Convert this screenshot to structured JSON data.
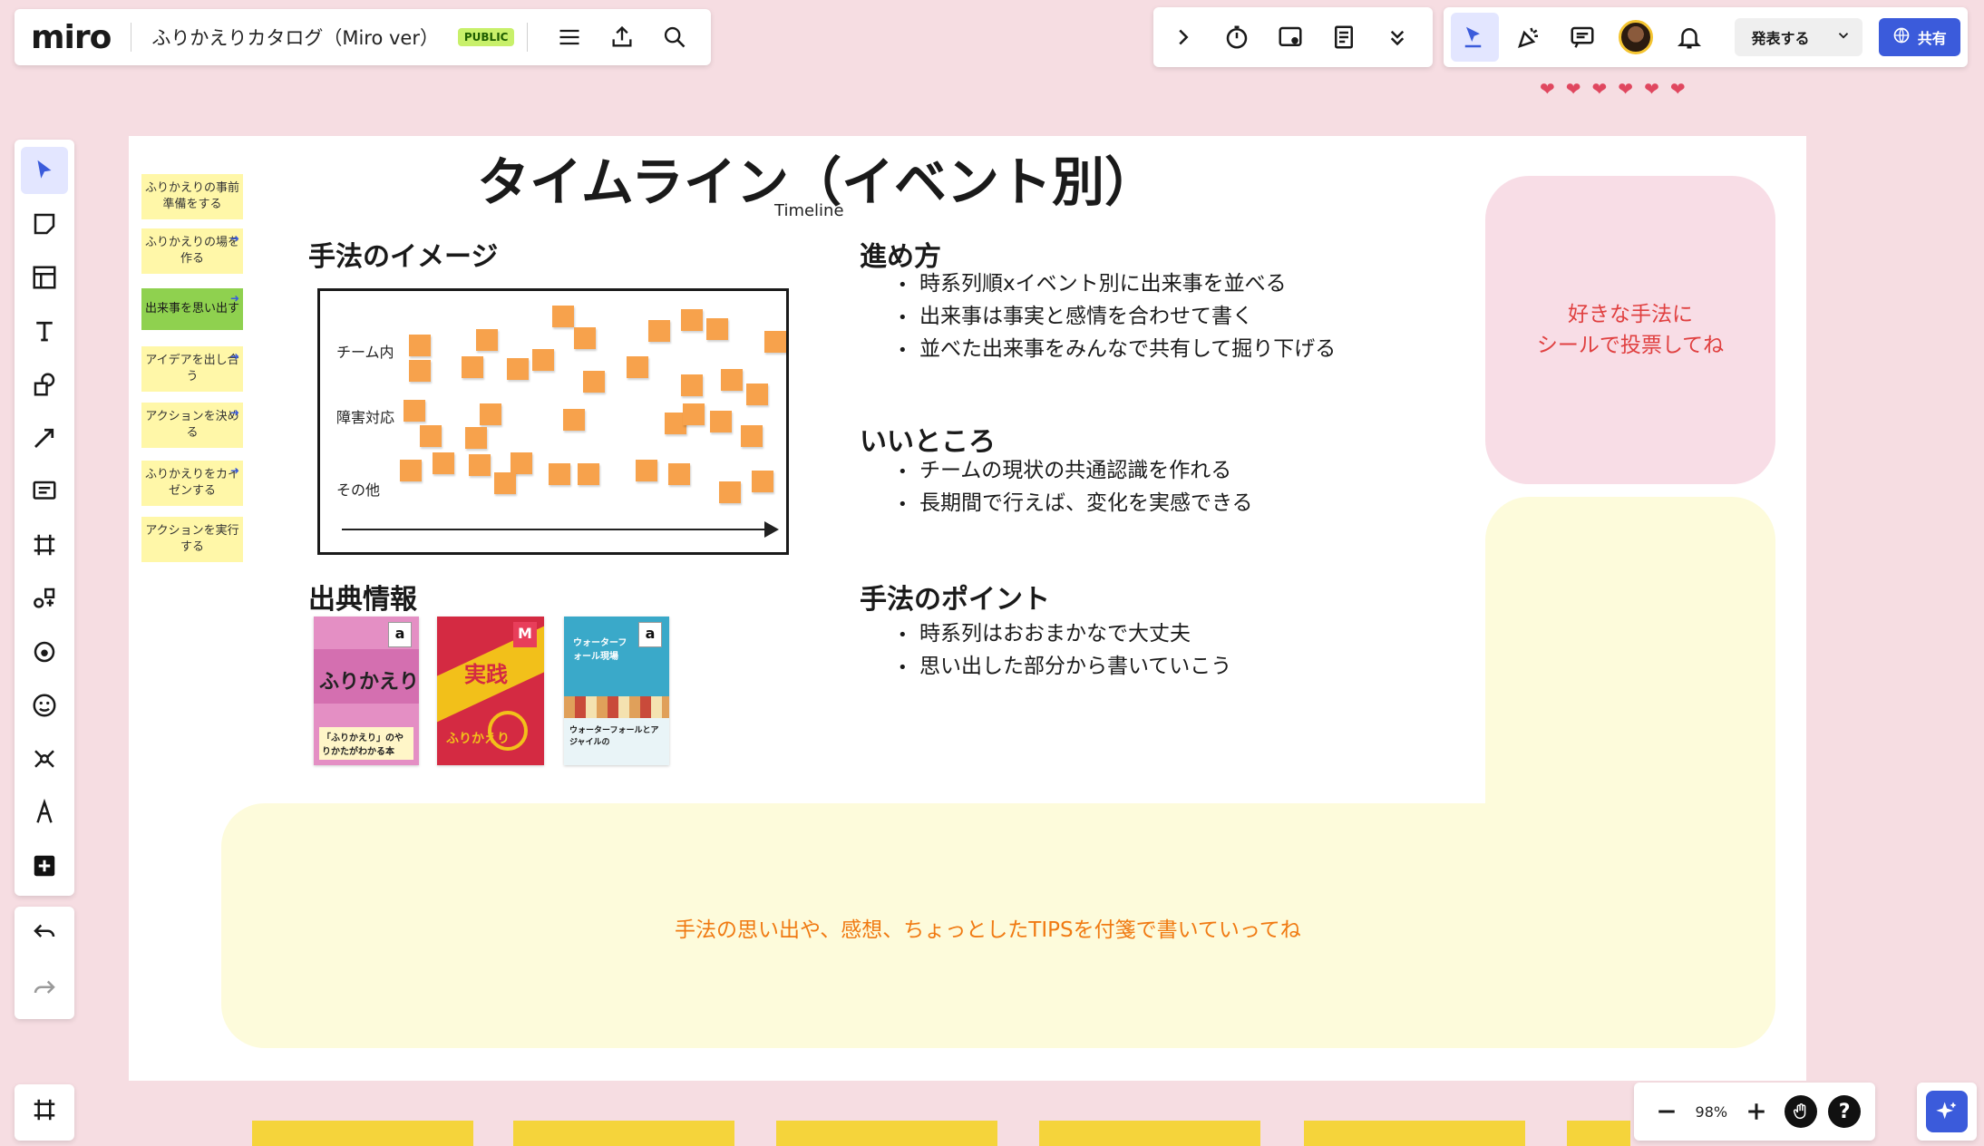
{
  "app": {
    "logo": "miro",
    "board_title": "ふりかえりカタログ（Miro ver）",
    "visibility_badge": "PUBLIC"
  },
  "header": {
    "present_label": "発表する",
    "share_label": "共有"
  },
  "zoom": {
    "level": "98%"
  },
  "help_label": "?",
  "board": {
    "title": "タイムライン（イベント別）",
    "subtitle": "Timeline",
    "side_notes": [
      {
        "label": "ふりかえりの事前準備をする"
      },
      {
        "label": "ふりかえりの場を作る"
      },
      {
        "label": "出来事を思い出す"
      },
      {
        "label": "アイデアを出し合う"
      },
      {
        "label": "アクションを決める"
      },
      {
        "label": "ふりかえりをカイゼンする"
      },
      {
        "label": "アクションを実行する"
      }
    ],
    "image_section": {
      "heading": "手法のイメージ",
      "rows": [
        "チーム内",
        "障害対応",
        "その他"
      ]
    },
    "sources_heading": "出典情報",
    "books": [
      {
        "title": "ふりかえり",
        "caption": "「ふりかえり」のやりかたがわかる本",
        "badge": "a",
        "color": "#d46fb0"
      },
      {
        "title": "実践",
        "caption": "ふりかえり",
        "badge": "M",
        "color": "#d42a42"
      },
      {
        "title": "ウォーターフォールとアジャイルの",
        "caption": "ウォーターフォール現場",
        "badge": "a",
        "color": "#3aa9c9"
      }
    ],
    "procedure": {
      "heading": "進め方",
      "items": [
        "時系列順xイベント別に出来事を並べる",
        "出来事は事実と感情を合わせて書く",
        "並べた出来事をみんなで共有して掘り下げる"
      ]
    },
    "benefits": {
      "heading": "いいところ",
      "items": [
        "チームの現状の共通認識を作れる",
        "長期間で行えば、変化を実感できる"
      ]
    },
    "points": {
      "heading": "手法のポイント",
      "items": [
        "時系列はおおまかなで大丈夫",
        "思い出した部分から書いていこう"
      ]
    },
    "vote_note": {
      "line1": "好きな手法に",
      "line2": "シールで投票してね"
    },
    "tips_note": "手法の思い出や、感想、ちょっとしたTIPSを付箋で書いていってね"
  },
  "colors": {
    "accent": "#3b5bdb",
    "sticky_orange": "#f7a24c",
    "sticky_yellow": "#fff7a8",
    "active_green": "#8fd14f",
    "public_badge": "#c8f06a",
    "vote_text": "#e04040",
    "tips_text": "#f07a12"
  }
}
